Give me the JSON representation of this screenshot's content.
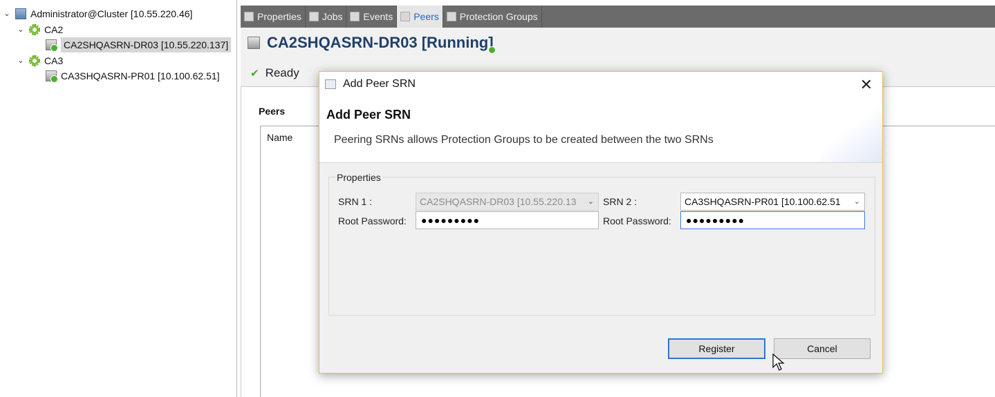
{
  "tree": {
    "root": "Administrator@Cluster [10.55.220.46]",
    "groups": [
      {
        "name": "CA2",
        "children": [
          "CA2SHQASRN-DR03 [10.55.220.137]"
        ]
      },
      {
        "name": "CA3",
        "children": [
          "CA3SHQASRN-PR01 [10.100.62.51]"
        ]
      }
    ]
  },
  "tabs": [
    "Properties",
    "Jobs",
    "Events",
    "Peers",
    "Protection Groups"
  ],
  "active_tab": "Peers",
  "page": {
    "title": "CA2SHQASRN-DR03 [Running]",
    "status": "Ready",
    "peers_label": "Peers",
    "col_name": "Name"
  },
  "dialog": {
    "window_title": "Add Peer SRN",
    "heading": "Add Peer SRN",
    "description": "Peering SRNs allows Protection Groups to be created between the two SRNs",
    "group_label": "Properties",
    "srn1_label": "SRN 1 :",
    "srn1_value": "CA2SHQASRN-DR03 [10.55.220.13",
    "srn2_label": "SRN 2 :",
    "srn2_value": "CA3SHQASRN-PR01 [10.100.62.51",
    "root_pw_label": "Root Password:",
    "pw1_value": "●●●●●●●●●",
    "pw2_value": "●●●●●●●●●",
    "register_label": "Register",
    "cancel_label": "Cancel",
    "close_glyph": "✕"
  },
  "colors": {
    "accent": "#2563c9",
    "title": "#1f3f6b",
    "ok_green": "#4aa82a",
    "tabbar": "#6b6b6b"
  }
}
